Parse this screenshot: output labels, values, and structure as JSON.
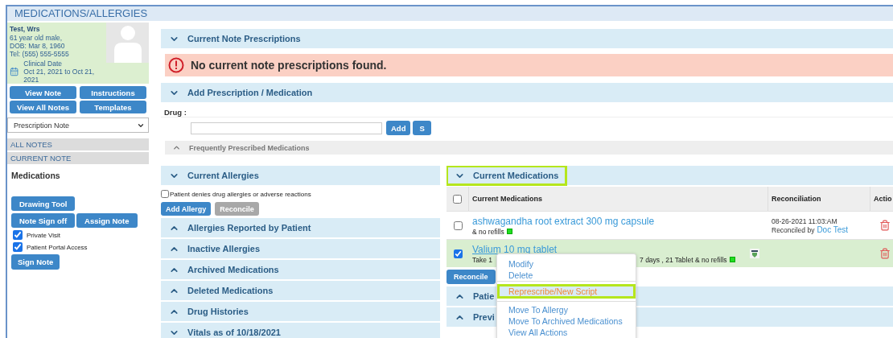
{
  "header": {
    "title": "MEDICATIONS/ALLERGIES"
  },
  "patient": {
    "name": "Test, Wrs",
    "age_sex": "61 year old male,",
    "dob": "DOB: Mar 8, 1960",
    "phone": "Tel: (555) 555-5555",
    "clinical_date_label": "Clinical Date",
    "clinical_date_range": "Oct 21, 2021 to Oct 21, 2021"
  },
  "note_buttons": [
    "View Note",
    "Instructions",
    "View All Notes",
    "Templates"
  ],
  "note_type_select": {
    "value": "Prescription Note"
  },
  "nav": [
    {
      "label": "ALL NOTES"
    },
    {
      "label": "CURRENT NOTE"
    }
  ],
  "current_section": "Medications",
  "tool_rows": [
    [
      "Drawing Tool"
    ],
    [
      "Note Sign off",
      "Assign Note"
    ]
  ],
  "options": [
    {
      "label": "Private Visit",
      "checked": true
    },
    {
      "label": "Patient Portal Access",
      "checked": true
    }
  ],
  "sign_button": "Sign Note",
  "note_prescriptions": {
    "title": "Current Note Prescriptions",
    "expanded": true,
    "alert": "No current note prescriptions found."
  },
  "add_prescription": {
    "title": "Add Prescription / Medication",
    "expanded": true,
    "drug_label": "Drug :",
    "buttons": [
      "Add",
      "S"
    ],
    "frequent": {
      "title": "Frequently Prescribed Medications",
      "expanded": false
    }
  },
  "allergies": {
    "title": "Current Allergies",
    "expanded": true,
    "denies": {
      "label": "Patient denies drug allergies or adverse reactions",
      "checked": false
    },
    "buttons": [
      {
        "label": "Add Allergy",
        "disabled": false
      },
      {
        "label": "Reconcile",
        "disabled": true
      }
    ]
  },
  "left_sections": [
    {
      "title": "Allergies Reported by Patient",
      "expanded": false
    },
    {
      "title": "Inactive Allergies",
      "expanded": false
    },
    {
      "title": "Archived Medications",
      "expanded": false
    },
    {
      "title": "Deleted Medications",
      "expanded": false
    },
    {
      "title": "Drug Histories",
      "expanded": false
    },
    {
      "title": "Vitals as of 10/18/2021",
      "expanded": true
    }
  ],
  "current_medications": {
    "title": "Current Medications",
    "expanded": true,
    "highlighted": true,
    "columns": [
      "Current Medications",
      "Reconciliation",
      "Actio"
    ],
    "all_checked": false,
    "rows": [
      {
        "name": "ashwagandha root extract 300 mg capsule",
        "sig": [
          "& no refills"
        ],
        "eprescribed": true,
        "monograph": false,
        "checked": false,
        "reconciled_at": "08-26-2021 11:03:AM",
        "reconciled_by_label": "Reconciled by",
        "reconciled_by": "Doc Test"
      },
      {
        "name": "Valium 10 mg tablet",
        "sig": [
          "Take 1",
          "7 days , 21 Tablet & no refills"
        ],
        "eprescribed": true,
        "monograph": true,
        "checked": true
      }
    ],
    "reconcile_button": "Reconcile",
    "sections": [
      {
        "title": "Patie",
        "expanded": false
      },
      {
        "title": "Previ",
        "expanded": false
      }
    ]
  },
  "context_menu": {
    "groups": [
      [
        {
          "label": "Modify",
          "selected": false
        },
        {
          "label": "Delete",
          "selected": false
        }
      ],
      [
        {
          "label": "Represcribe/New Script",
          "selected": true
        }
      ],
      [
        {
          "label": "Move To Allergy",
          "selected": false
        },
        {
          "label": "Move To Archived Medications",
          "selected": false
        },
        {
          "label": "View All Actions",
          "selected": false
        }
      ]
    ]
  }
}
